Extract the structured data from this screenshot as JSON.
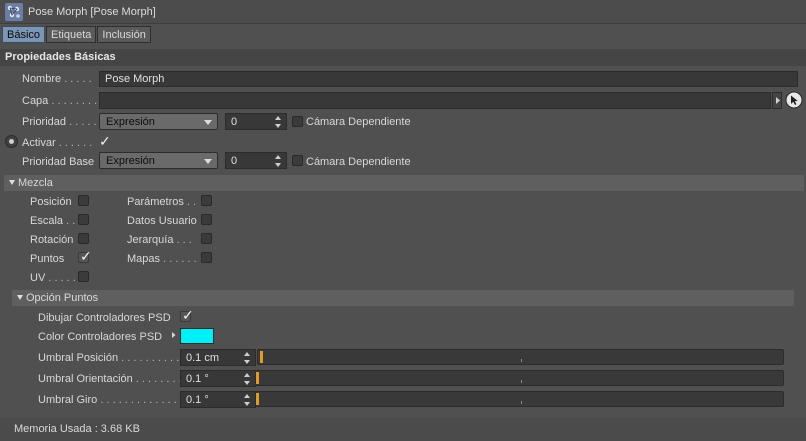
{
  "window": {
    "title": "Pose Morph [Pose Morph]",
    "icon": "pose-morph-tag-icon"
  },
  "tabs": [
    {
      "label": "Básico",
      "active": true
    },
    {
      "label": "Etiqueta",
      "active": false
    },
    {
      "label": "Inclusión",
      "active": false
    }
  ],
  "basic": {
    "header": "Propiedades Básicas",
    "name_label": "Nombre",
    "name_value": "Pose Morph",
    "layer_label": "Capa",
    "layer_value": "",
    "priority_label": "Prioridad",
    "priority_mode": "Expresión",
    "priority_value": "0",
    "camera_dependent_label": "Cámara Dependiente",
    "camera_dependent_checked": false,
    "activate_label": "Activar",
    "activate_checked": true,
    "base_priority_label": "Prioridad Base",
    "base_priority_mode": "Expresión",
    "base_priority_value": "0",
    "base_camera_dependent_label": "Cámara Dependiente",
    "base_camera_dependent_checked": false
  },
  "mix": {
    "header": "Mezcla",
    "left": [
      {
        "label": "Posición",
        "checked": false
      },
      {
        "label": "Escala",
        "checked": false
      },
      {
        "label": "Rotación",
        "checked": false
      },
      {
        "label": "Puntos",
        "checked": true
      },
      {
        "label": "UV",
        "checked": false
      }
    ],
    "right": [
      {
        "label": "Parámetros",
        "checked": false
      },
      {
        "label": "Datos Usuario",
        "checked": false
      },
      {
        "label": "Jerarquía",
        "checked": false
      },
      {
        "label": "Mapas",
        "checked": false
      }
    ]
  },
  "points": {
    "header": "Opción Puntos",
    "draw_psd_label": "Dibujar Controladores PSD",
    "draw_psd_checked": true,
    "color_psd_label": "Color Controladores PSD",
    "color_psd": "#00f0f8",
    "sliders": [
      {
        "label": "Umbral Posición",
        "value": "0.1 cm",
        "fraction": 0.003
      },
      {
        "label": "Umbral Orientación",
        "value": "0.1 °",
        "fraction": 0.0
      },
      {
        "label": "Umbral Giro",
        "value": "0.1 °",
        "fraction": 0.0
      }
    ]
  },
  "footer": {
    "memory_text": "Memoria Usada : 3.68 KB"
  },
  "colors": {
    "accent_tab": "#7b95b5",
    "slider_handle": "#e09a2c",
    "background": "#505050"
  }
}
